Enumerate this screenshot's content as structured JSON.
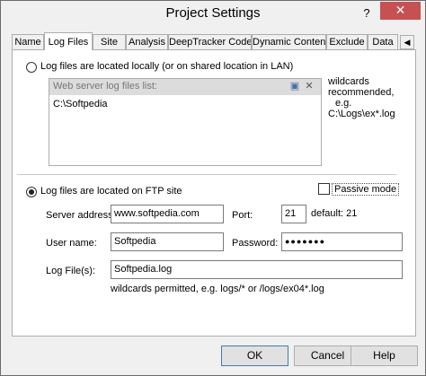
{
  "window": {
    "title": "Project Settings",
    "help_glyph": "?",
    "close_glyph": "✕"
  },
  "tabs": [
    {
      "label": "Name"
    },
    {
      "label": "Log Files"
    },
    {
      "label": "Site"
    },
    {
      "label": "Analysis"
    },
    {
      "label": "DeepTracker Code"
    },
    {
      "label": "Dynamic Content"
    },
    {
      "label": "Exclude"
    },
    {
      "label": "Data"
    }
  ],
  "local": {
    "radio_label": "Log files are located locally (or on shared location in LAN)",
    "list_header": "Web server log files list:",
    "list_items": [
      "C:\\Softpedia"
    ],
    "hint_line1": "wildcards",
    "hint_line2": "recommended,",
    "hint_line3": "e.g.",
    "hint_line4": "C:\\Logs\\ex*.log"
  },
  "ftp": {
    "radio_label": "Log files are located on FTP site",
    "passive_label": "Passive mode",
    "server_label": "Server address:",
    "server_value": "www.softpedia.com",
    "port_label": "Port:",
    "port_value": "21",
    "port_default": "default: 21",
    "user_label": "User name:",
    "user_value": "Softpedia",
    "password_label": "Password:",
    "password_value": "●●●●●●●",
    "logfile_label": "Log File(s):",
    "logfile_value": "Softpedia.log",
    "wildcard_hint": "wildcards permitted, e.g. logs/* or /logs/ex04*.log"
  },
  "buttons": {
    "ok": "OK",
    "cancel": "Cancel",
    "help": "Help"
  }
}
